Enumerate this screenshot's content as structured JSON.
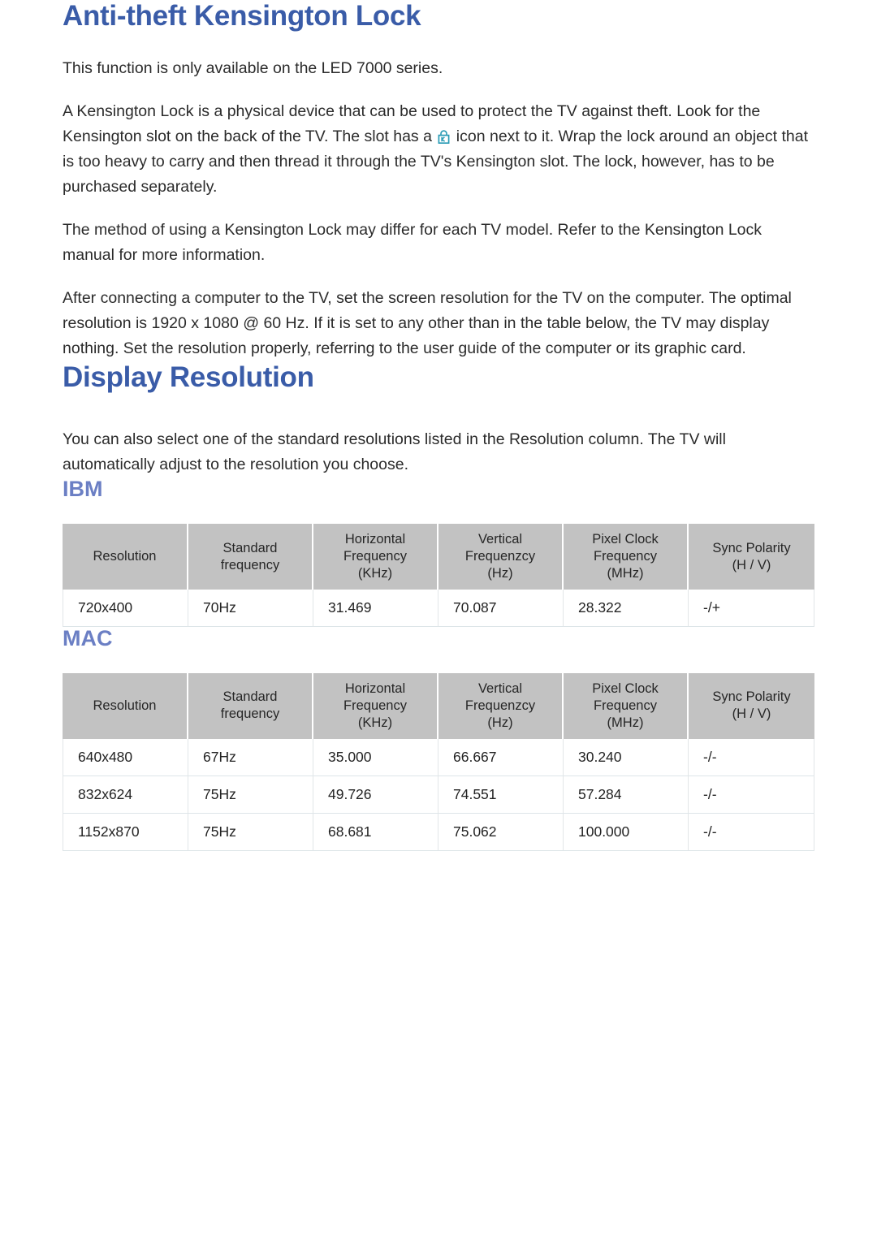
{
  "sections": {
    "kensington": {
      "heading": "Anti-theft Kensington Lock",
      "paragraphs": [
        "This function is only available on the LED 7000 series.",
        {
          "before": "A Kensington Lock is a physical device that can be used to protect the TV against theft. Look for the Kensington slot on the back of the TV. The slot has a ",
          "icon": "kensington-lock-icon",
          "icon_color": "#2a9bb5",
          "after": " icon next to it. Wrap the lock around an object that is too heavy to carry and then thread it through the TV's Kensington slot. The lock, however, has to be purchased separately."
        },
        "The method of using a Kensington Lock may differ for each TV model. Refer to the Kensington Lock manual for more information.",
        "After connecting a computer to the TV, set the screen resolution for the TV on the computer. The optimal resolution is 1920 x 1080 @ 60 Hz. If it is set to any other than in the table below, the TV may display nothing. Set the resolution properly, referring to the user guide of the computer or its graphic card."
      ]
    },
    "display_resolution": {
      "heading": "Display Resolution",
      "intro": "You can also select one of the standard resolutions listed in the Resolution column. The TV will automatically adjust to the resolution you choose."
    }
  },
  "tables": {
    "columns": [
      {
        "line1": "Resolution",
        "line2": "",
        "unit": ""
      },
      {
        "line1": "Standard",
        "line2": "frequency",
        "unit": ""
      },
      {
        "line1": "Horizontal",
        "line2": "Frequency",
        "unit": "(KHz)"
      },
      {
        "line1": "Vertical",
        "line2": "Frequenzcy",
        "unit": "(Hz)"
      },
      {
        "line1": "Pixel Clock",
        "line2": "Frequency",
        "unit": "(MHz)"
      },
      {
        "line1": "Sync Polarity",
        "line2": "",
        "unit": "(H / V)"
      }
    ],
    "ibm": {
      "title": "IBM",
      "rows": [
        [
          "720x400",
          "70Hz",
          "31.469",
          "70.087",
          "28.322",
          "-/+"
        ]
      ]
    },
    "mac": {
      "title": "MAC",
      "rows": [
        [
          "640x480",
          "67Hz",
          "35.000",
          "66.667",
          "30.240",
          "-/-"
        ],
        [
          "832x624",
          "75Hz",
          "49.726",
          "74.551",
          "57.284",
          "-/-"
        ],
        [
          "1152x870",
          "75Hz",
          "68.681",
          "75.062",
          "100.000",
          "-/-"
        ]
      ]
    }
  },
  "colors": {
    "heading_blue": "#3a5ca8",
    "subheading_blue": "#6b7fc4",
    "table_header_bg": "#c2c2c2",
    "row_separator": "#dde5e8",
    "body_text": "#2b2b2b",
    "icon_teal": "#2a9bb5"
  }
}
